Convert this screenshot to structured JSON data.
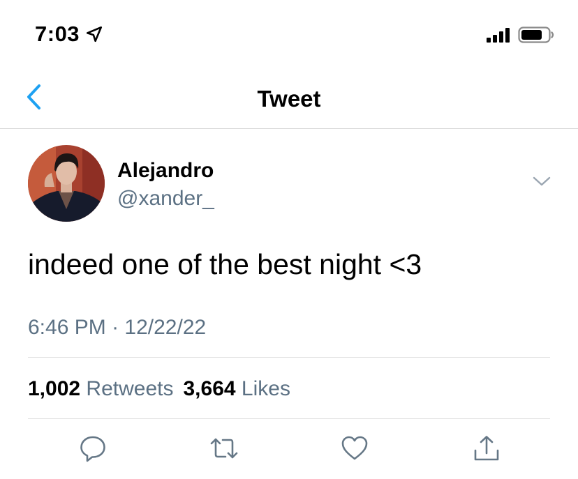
{
  "status_bar": {
    "time": "7:03",
    "location_icon": "location-arrow-icon",
    "signal_icon": "cellular-signal-icon",
    "battery_icon": "battery-icon"
  },
  "nav": {
    "title": "Tweet",
    "back_icon": "chevron-left-icon"
  },
  "tweet": {
    "author": {
      "display_name": "Alejandro",
      "handle": "@xander_"
    },
    "text": "indeed one of the best night <3",
    "time": "6:46 PM",
    "separator": "·",
    "date": "12/22/22",
    "retweets": {
      "count": "1,002",
      "label": "Retweets"
    },
    "likes": {
      "count": "3,664",
      "label": "Likes"
    }
  },
  "actions": [
    {
      "name": "reply",
      "icon": "reply-icon"
    },
    {
      "name": "retweet",
      "icon": "retweet-icon"
    },
    {
      "name": "like",
      "icon": "heart-icon"
    },
    {
      "name": "share",
      "icon": "share-icon"
    }
  ],
  "colors": {
    "accent": "#1da1f2",
    "secondary_text": "#5b7083",
    "divider": "#e1e1e1"
  }
}
